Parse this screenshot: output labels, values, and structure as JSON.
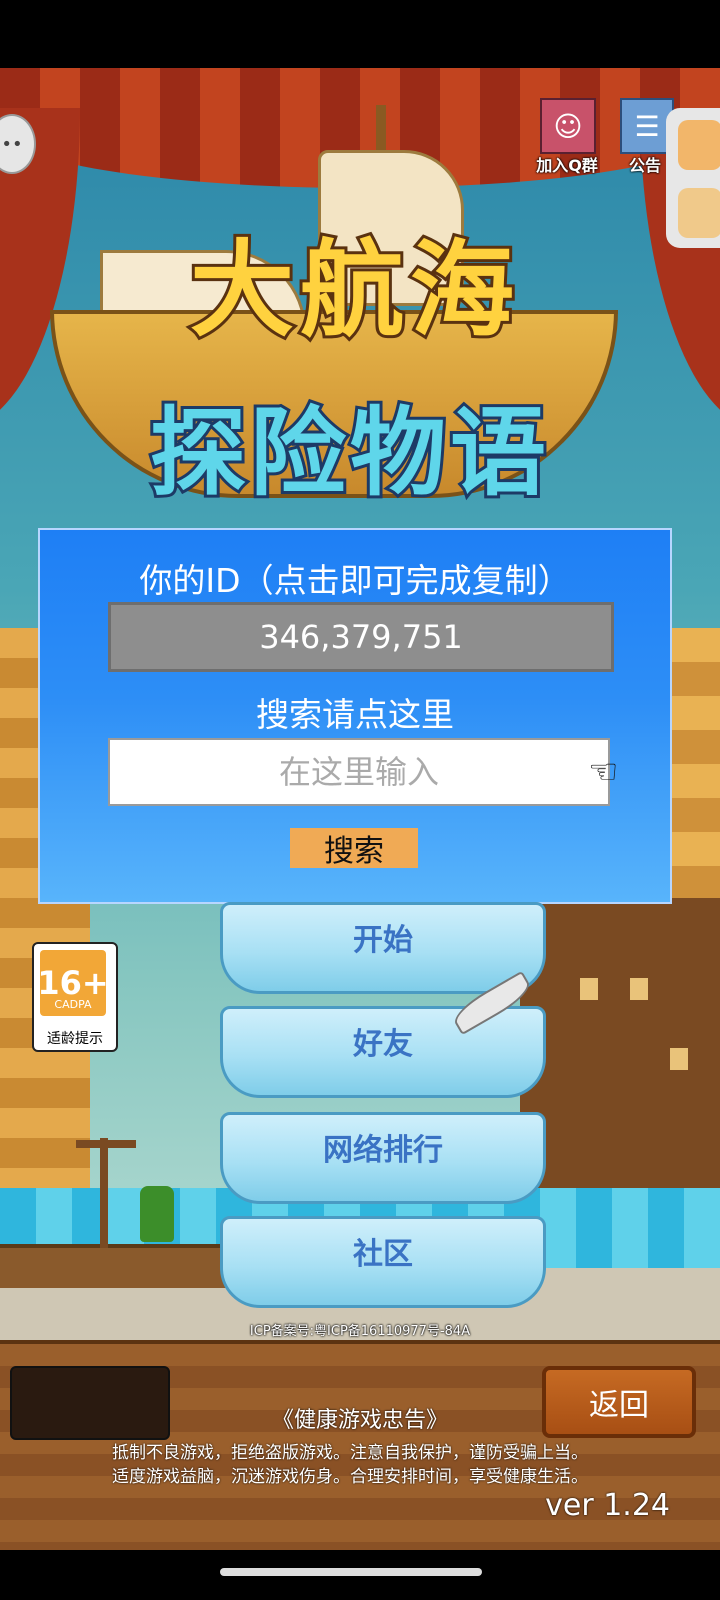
{
  "game_title": {
    "line1": "大航海",
    "line2": "探险物语"
  },
  "top_buttons": {
    "join_qq_group": "加入Q群",
    "notice": "公告"
  },
  "id_panel": {
    "title": "你的ID（点击即可完成复制）",
    "id_value": "346,379,751",
    "search_hint": "搜索请点这里",
    "search_placeholder": "在这里输入",
    "search_button": "搜索"
  },
  "menu": {
    "start": "开始",
    "friends": "好友",
    "ranking": "网络排行",
    "community": "社区"
  },
  "age_rating": {
    "age": "16+",
    "org": "CADPA",
    "label": "适龄提示"
  },
  "icp": "ICP备案号:粤ICP备16110977号-84A",
  "footer": {
    "back_button": "返回",
    "health_title": "《健康游戏忠告》",
    "health_line1": "抵制不良游戏，拒绝盗版游戏。注意自我保护，谨防受骗上当。",
    "health_line2": "适度游戏益脑，沉迷游戏伤身。合理安排时间，享受健康生活。",
    "version": "ver 1.24"
  }
}
